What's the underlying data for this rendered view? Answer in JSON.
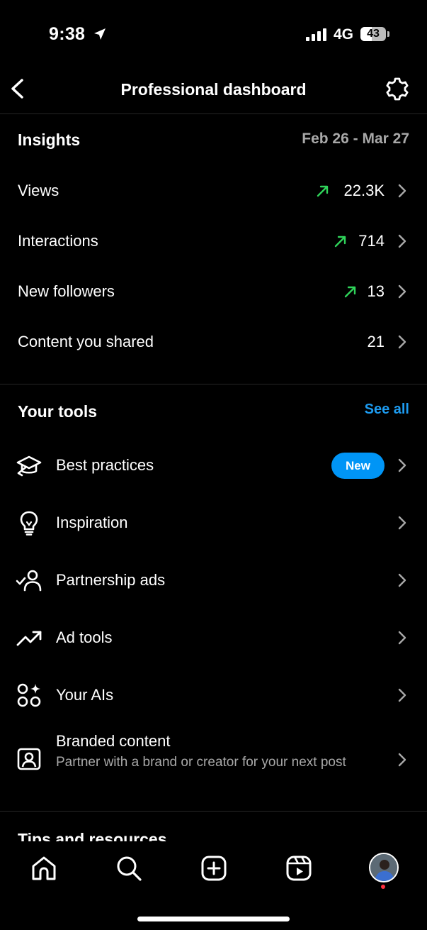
{
  "status_bar": {
    "time": "9:38",
    "network": "4G",
    "battery": "43"
  },
  "header": {
    "title": "Professional dashboard"
  },
  "insights": {
    "title": "Insights",
    "date_range": "Feb 26 - Mar 27",
    "rows": [
      {
        "label": "Views",
        "value": "22.3K",
        "trend": "up"
      },
      {
        "label": "Interactions",
        "value": "714",
        "trend": "up"
      },
      {
        "label": "New followers",
        "value": "13",
        "trend": "up"
      },
      {
        "label": "Content you shared",
        "value": "21",
        "trend": "none"
      }
    ]
  },
  "tools": {
    "title": "Your tools",
    "see_all": "See all",
    "items": [
      {
        "label": "Best practices",
        "icon": "graduation-cap-icon",
        "badge": "New"
      },
      {
        "label": "Inspiration",
        "icon": "lightbulb-icon"
      },
      {
        "label": "Partnership ads",
        "icon": "person-check-icon"
      },
      {
        "label": "Ad tools",
        "icon": "trending-up-icon"
      },
      {
        "label": "Your AIs",
        "icon": "ai-shapes-icon"
      },
      {
        "label": "Branded content",
        "icon": "branded-content-icon",
        "subtitle": "Partner with a brand or creator for your next post"
      }
    ]
  },
  "tips": {
    "title": "Tips and resources"
  },
  "colors": {
    "accent": "#0095f6",
    "trend_up": "#2fd35a",
    "muted": "#a8a8a8",
    "link": "#1d9bf0"
  }
}
